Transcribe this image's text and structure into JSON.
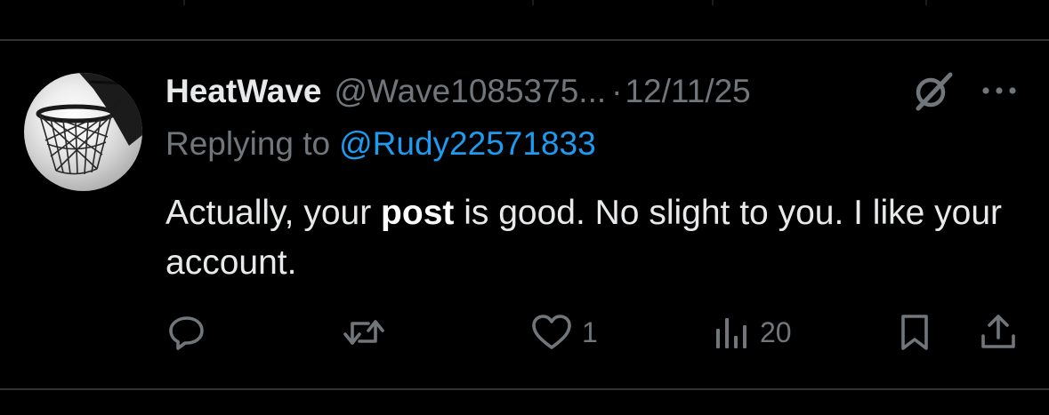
{
  "post": {
    "display_name": "HeatWave",
    "handle": "@Wave1085375...",
    "separator": "·",
    "date": "12/11/25",
    "replying_to_label": "Replying to",
    "replying_to_handle": "@Rudy22571833",
    "text_part1": "Actually, your ",
    "text_bold": "post",
    "text_part2": " is good. No slight to you.  I like your account."
  },
  "actions": {
    "reply_icon": "reply-icon",
    "retweet_icon": "retweet-icon",
    "like_icon": "heart-icon",
    "like_count": "1",
    "views_icon": "views-icon",
    "views_count": "20",
    "bookmark_icon": "bookmark-icon",
    "share_icon": "share-icon"
  },
  "header_icons": {
    "grok": "grok-icon",
    "more": "more-icon"
  },
  "colors": {
    "background": "#000000",
    "text": "#e7e9ea",
    "secondary": "#71767b",
    "link": "#1d9bf0",
    "divider": "#2f3336"
  }
}
